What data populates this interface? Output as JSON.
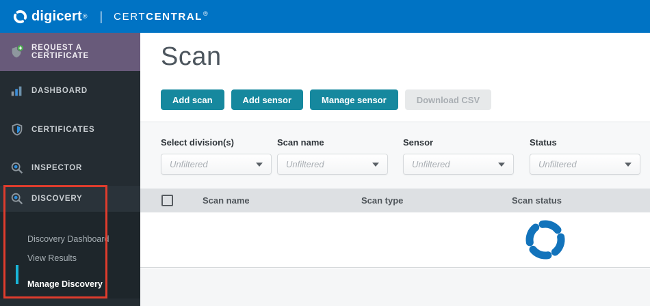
{
  "header": {
    "brand": "digicert",
    "brand_reg": "®",
    "divider": "|",
    "product_cert": "CERT",
    "product_central": "CENTRAL",
    "product_reg": "®"
  },
  "sidebar": {
    "items": [
      {
        "label": "REQUEST A CERTIFICATE",
        "icon": "shield-plus-icon"
      },
      {
        "label": "DASHBOARD",
        "icon": "bar-chart-icon"
      },
      {
        "label": "CERTIFICATES",
        "icon": "shield-icon"
      },
      {
        "label": "INSPECTOR",
        "icon": "magnifier-icon"
      },
      {
        "label": "DISCOVERY",
        "icon": "magnifier-icon"
      }
    ],
    "submenu": [
      {
        "label": "Discovery Dashboard",
        "active": false
      },
      {
        "label": "View Results",
        "active": false
      },
      {
        "label": "Manage Discovery",
        "active": true
      }
    ]
  },
  "main": {
    "title": "Scan",
    "toolbar": {
      "add_scan": "Add scan",
      "add_sensor": "Add sensor",
      "manage_sensor": "Manage sensor",
      "download_csv": "Download CSV",
      "download_csv_enabled": false
    },
    "filters": [
      {
        "label": "Select division(s)",
        "value": "Unfiltered"
      },
      {
        "label": "Scan name",
        "value": "Unfiltered"
      },
      {
        "label": "Sensor",
        "value": "Unfiltered"
      },
      {
        "label": "Status",
        "value": "Unfiltered"
      }
    ],
    "table": {
      "columns": [
        {
          "label": "Scan name"
        },
        {
          "label": "Scan type"
        },
        {
          "label": "Scan status"
        }
      ],
      "rows": [],
      "state": "loading"
    }
  },
  "colors": {
    "header_blue": "#0073c4",
    "sidebar_dark": "#242c32",
    "request_purple": "#685a7a",
    "button_teal": "#16889e",
    "spinner_blue": "#1273bb",
    "highlight_red": "#e03c2d",
    "active_cyan": "#19b5d8",
    "table_header_gray": "#dde0e3"
  }
}
